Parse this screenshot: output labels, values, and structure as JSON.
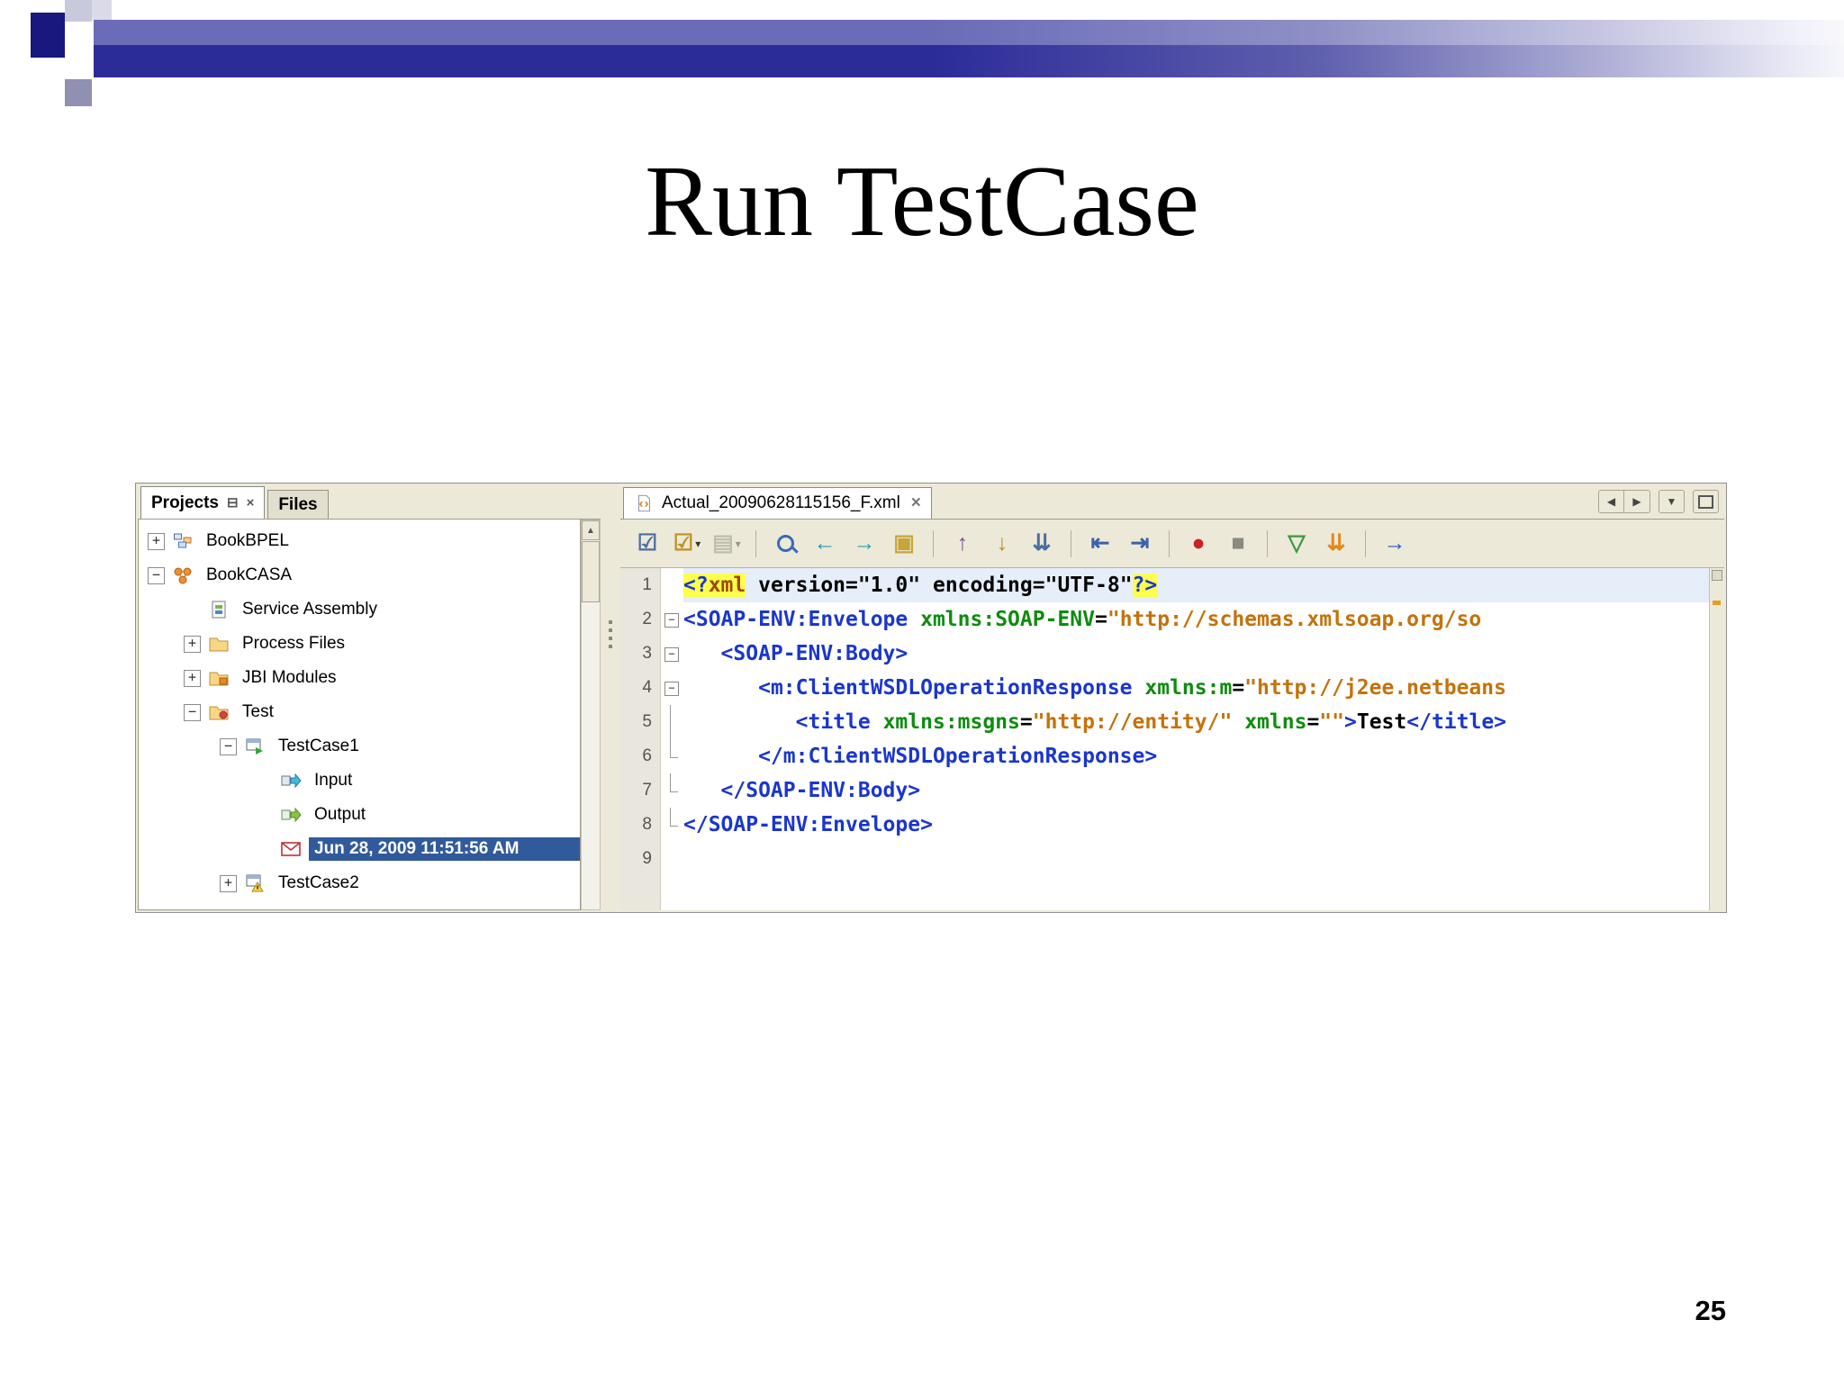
{
  "slide": {
    "title": "Run TestCase",
    "page_number": "25"
  },
  "theme": {
    "banner_dark": "#2c2c99",
    "chrome_bg": "#ece9d8",
    "selection_bg": "#305a9b",
    "occurrence_highlight": "#ffff4d",
    "tag_color": "#1a36cc",
    "attr_color": "#0e8c0e",
    "value_color": "#c4720a"
  },
  "left_panel": {
    "tabs": [
      {
        "label": "Projects",
        "active": true
      },
      {
        "label": "Files",
        "active": false
      }
    ],
    "window_buttons": {
      "minimize_glyph": "⊟",
      "close_glyph": "×"
    },
    "scrollbar_up_glyph": "▲",
    "tree": [
      {
        "label": "BookBPEL",
        "level": 0,
        "toggle": "plus",
        "icon": "bpel-project-icon"
      },
      {
        "label": "BookCASA",
        "level": 0,
        "toggle": "minus",
        "icon": "casa-project-icon"
      },
      {
        "label": "Service Assembly",
        "level": 1,
        "toggle": "none",
        "icon": "service-assembly-icon"
      },
      {
        "label": "Process Files",
        "level": 1,
        "toggle": "plus",
        "icon": "folder-icon"
      },
      {
        "label": "JBI Modules",
        "level": 1,
        "toggle": "plus",
        "icon": "jbi-folder-icon"
      },
      {
        "label": "Test",
        "level": 1,
        "toggle": "minus",
        "icon": "test-folder-icon"
      },
      {
        "label": "TestCase1",
        "level": 2,
        "toggle": "minus",
        "icon": "testcase-icon"
      },
      {
        "label": "Input",
        "level": 3,
        "toggle": "none",
        "icon": "input-icon"
      },
      {
        "label": "Output",
        "level": 3,
        "toggle": "none",
        "icon": "output-icon"
      },
      {
        "label": "Jun 28, 2009 11:51:56 AM",
        "level": 3,
        "toggle": "none",
        "icon": "result-mail-icon",
        "selected": true
      },
      {
        "label": "TestCase2",
        "level": 2,
        "toggle": "plus",
        "icon": "testcase-warning-icon"
      }
    ]
  },
  "editor": {
    "tab": {
      "icon": "xml-file-icon",
      "label": "Actual_20090628115156_F.xml",
      "close_glyph": "×"
    },
    "tab_controls": {
      "scroll_left_glyph": "◀",
      "scroll_right_glyph": "▶",
      "list_glyph": "▼"
    },
    "toolbar_groups": [
      [
        {
          "name": "validate-xml-button",
          "glyph": "☑",
          "color": "#4a6da0"
        },
        {
          "name": "check-xml-button",
          "glyph": "☑",
          "color": "#c09020",
          "caret": true
        },
        {
          "name": "xsl-transform-button",
          "glyph": "▤",
          "color": "#8a8a7e",
          "caret": true,
          "disabled": true
        }
      ],
      [
        {
          "name": "find-button",
          "glyph": "magnifier",
          "color": "#3a6ab8"
        },
        {
          "name": "jump-back-button",
          "glyph": "←",
          "color": "#2a9ab0"
        },
        {
          "name": "jump-forward-button",
          "glyph": "→",
          "color": "#2a9ab0"
        },
        {
          "name": "toggle-highlight-search-button",
          "glyph": "▣",
          "color": "#c7a53a"
        }
      ],
      [
        {
          "name": "previous-occurrence-button",
          "glyph": "↑",
          "color": "#8050a0"
        },
        {
          "name": "next-occurrence-button",
          "glyph": "↓",
          "color": "#c09020"
        },
        {
          "name": "select-in-projects-button",
          "glyph": "⇊",
          "color": "#4a6da0"
        }
      ],
      [
        {
          "name": "shift-line-left-button",
          "glyph": "⇤",
          "color": "#3a62aa"
        },
        {
          "name": "shift-line-right-button",
          "glyph": "⇥",
          "color": "#3a62aa"
        }
      ],
      [
        {
          "name": "start-macro-recording-button",
          "glyph": "●",
          "color": "#cc2222"
        },
        {
          "name": "stop-macro-recording-button",
          "glyph": "■",
          "color": "#8a8a7e"
        }
      ],
      [
        {
          "name": "next-bookmark-button",
          "glyph": "▽",
          "color": "#3a9a3a"
        },
        {
          "name": "previous-bookmark-button",
          "glyph": "⇊",
          "color": "#e08820"
        }
      ],
      [
        {
          "name": "jump-to-last-edit-button",
          "glyph": "→",
          "color": "#2255cc"
        }
      ]
    ],
    "code": {
      "lines": [
        {
          "n": "1",
          "fold": "none",
          "current": true,
          "segs": [
            {
              "t": "<?",
              "c": "tag hl"
            },
            {
              "t": "xml",
              "c": "pit hl"
            },
            {
              "t": " version=",
              "c": "pln"
            },
            {
              "t": "\"1.0\"",
              "c": "pln"
            },
            {
              "t": " encoding=",
              "c": "pln"
            },
            {
              "t": "\"UTF-8\"",
              "c": "pln"
            },
            {
              "t": "?>",
              "c": "tag hl"
            }
          ]
        },
        {
          "n": "2",
          "fold": "box",
          "segs": [
            {
              "t": "<SOAP-ENV:Envelope",
              "c": "tag"
            },
            {
              "t": " ",
              "c": "pln"
            },
            {
              "t": "xmlns:SOAP-ENV",
              "c": "attr"
            },
            {
              "t": "=",
              "c": "pln"
            },
            {
              "t": "\"http://schemas.xmlsoap.org/so",
              "c": "val"
            }
          ]
        },
        {
          "n": "3",
          "fold": "box",
          "segs": [
            {
              "t": "   ",
              "c": "pln"
            },
            {
              "t": "<SOAP-ENV:Body>",
              "c": "tag"
            }
          ]
        },
        {
          "n": "4",
          "fold": "box",
          "segs": [
            {
              "t": "      ",
              "c": "pln"
            },
            {
              "t": "<m:ClientWSDLOperationResponse",
              "c": "tag"
            },
            {
              "t": " ",
              "c": "pln"
            },
            {
              "t": "xmlns:m",
              "c": "attr"
            },
            {
              "t": "=",
              "c": "pln"
            },
            {
              "t": "\"http://j2ee.netbeans",
              "c": "val"
            }
          ]
        },
        {
          "n": "5",
          "fold": "line",
          "segs": [
            {
              "t": "         ",
              "c": "pln"
            },
            {
              "t": "<title",
              "c": "tag"
            },
            {
              "t": " ",
              "c": "pln"
            },
            {
              "t": "xmlns:msgns",
              "c": "attr"
            },
            {
              "t": "=",
              "c": "pln"
            },
            {
              "t": "\"http://entity/\"",
              "c": "val"
            },
            {
              "t": " ",
              "c": "pln"
            },
            {
              "t": "xmlns",
              "c": "attr"
            },
            {
              "t": "=",
              "c": "pln"
            },
            {
              "t": "\"\"",
              "c": "val"
            },
            {
              "t": ">",
              "c": "tag"
            },
            {
              "t": "Test",
              "c": "pln"
            },
            {
              "t": "</title>",
              "c": "tag"
            }
          ]
        },
        {
          "n": "6",
          "fold": "end",
          "segs": [
            {
              "t": "      ",
              "c": "pln"
            },
            {
              "t": "</m:ClientWSDLOperationResponse>",
              "c": "tag"
            }
          ]
        },
        {
          "n": "7",
          "fold": "end",
          "segs": [
            {
              "t": "   ",
              "c": "pln"
            },
            {
              "t": "</SOAP-ENV:Body>",
              "c": "tag"
            }
          ]
        },
        {
          "n": "8",
          "fold": "end",
          "segs": [
            {
              "t": "</SOAP-ENV:Envelope>",
              "c": "tag"
            }
          ]
        },
        {
          "n": "9",
          "fold": "none",
          "segs": []
        }
      ]
    }
  }
}
